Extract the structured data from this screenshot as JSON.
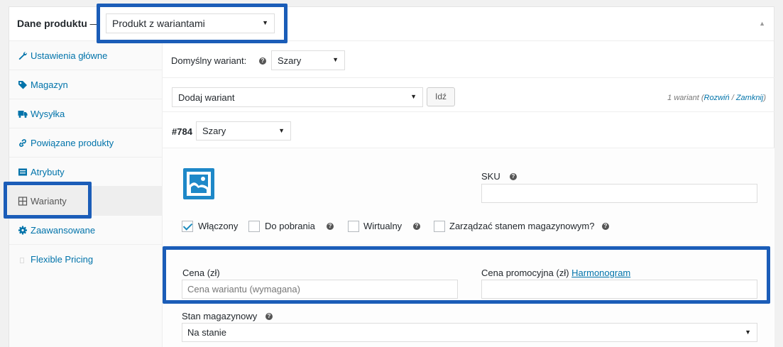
{
  "colors": {
    "highlight": "#1b5db8",
    "link": "#0073aa",
    "checkmark": "#1e8cbe"
  },
  "header": {
    "title": "Dane produktu",
    "dash": "—",
    "product_type": "Produkt z wariantami",
    "collapse_icon": "triangle-up-icon"
  },
  "sidebar": {
    "items": [
      {
        "label": "Ustawienia główne",
        "icon": "wrench-icon"
      },
      {
        "label": "Magazyn",
        "icon": "tag-icon"
      },
      {
        "label": "Wysyłka",
        "icon": "truck-icon"
      },
      {
        "label": "Powiązane produkty",
        "icon": "link-icon"
      },
      {
        "label": "Atrybuty",
        "icon": "list-icon"
      },
      {
        "label": "Warianty",
        "icon": "grid-icon"
      },
      {
        "label": "Zaawansowane",
        "icon": "gear-icon"
      },
      {
        "label": "Flexible Pricing",
        "icon": "box-icon"
      }
    ],
    "active": "Warianty"
  },
  "main": {
    "default_variant_label": "Domyślny wariant:",
    "default_variant_value": "Szary",
    "add_variant_select": "Dodaj wariant",
    "go_button": "Idź",
    "variant_count": "1 wariant",
    "expand_link": "Rozwiń",
    "link_separator": "/",
    "collapse_link": "Zamknij",
    "variant": {
      "id": "#784",
      "attribute_value": "Szary",
      "image_icon": "image-placeholder-icon",
      "sku_label": "SKU",
      "sku_value": "",
      "checkboxes": [
        {
          "label": "Włączony",
          "checked": true
        },
        {
          "label": "Do pobrania",
          "checked": false
        },
        {
          "label": "Wirtualny",
          "checked": false
        },
        {
          "label": "Zarządzać stanem magazynowym?",
          "checked": false
        }
      ],
      "price_label": "Cena (zł)",
      "price_placeholder": "Cena wariantu (wymagana)",
      "promo_label": "Cena promocyjna (zł)",
      "promo_link": "Harmonogram",
      "promo_value": "",
      "stock_label": "Stan magazynowy",
      "stock_value": "Na stanie"
    }
  },
  "help_glyph": "?",
  "caret_glyph": "▼"
}
